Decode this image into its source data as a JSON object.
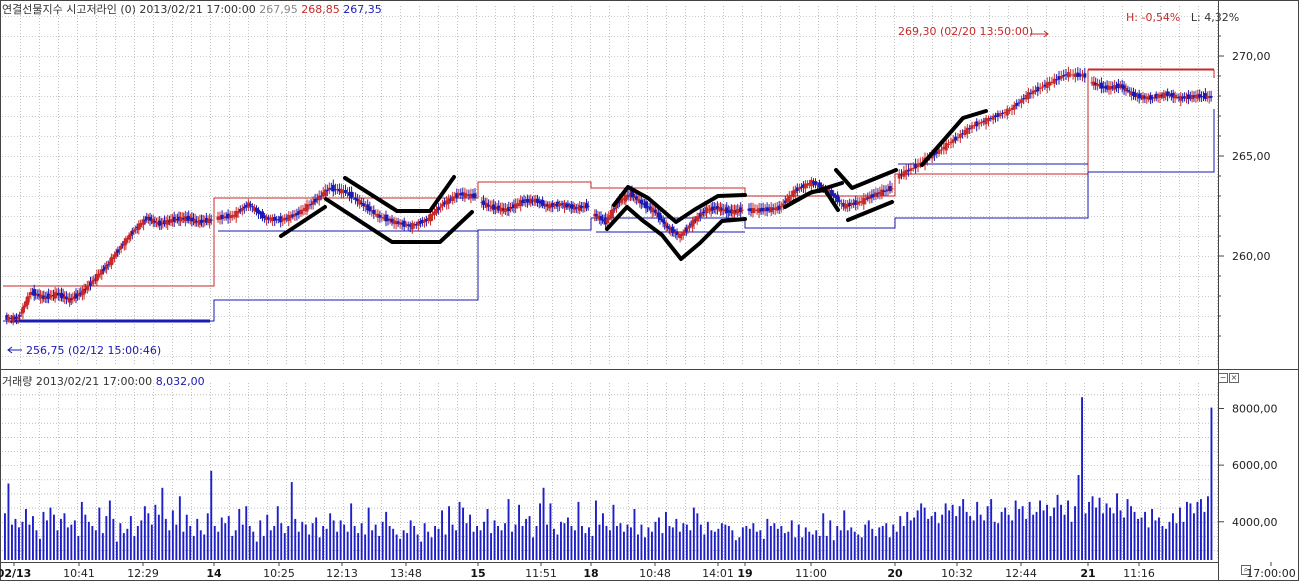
{
  "header": {
    "title": "연결선물지수 시고저라인",
    "param": "(0)",
    "datetime": "2013/02/21 17:00:00",
    "open": "267,95",
    "high": "268,85",
    "low": "267,35",
    "range_h": "H: -0,54%",
    "range_l": "L: 4,32%"
  },
  "volume_header": {
    "title": "거래량",
    "datetime": "2013/02/21 17:00:00",
    "value": "8,032,00"
  },
  "annotations": {
    "max_label": "269,30 (02/20 13:50:00)",
    "min_label": "256,75 (02/12 15:00:46)"
  },
  "chart_data": [
    {
      "type": "candlestick",
      "title": "연결선물지수 시고저라인",
      "y_ticks": [
        "270,00",
        "265,00",
        "260,00"
      ],
      "y_tick_values": [
        270,
        265,
        260
      ],
      "ylim": [
        254.5,
        272.5
      ],
      "x_tick_labels": [
        "02/13",
        "10:41",
        "12:29",
        "14",
        "10:25",
        "12:13",
        "13:48",
        "15",
        "11:51",
        "18",
        "10:48",
        "14:01",
        "19",
        "11:00",
        "20",
        "10:32",
        "12:44",
        "21",
        "11:16",
        "17:00:00"
      ],
      "day_labels": [
        "02/13",
        "14",
        "15",
        "18",
        "19",
        "20",
        "21"
      ],
      "grid": true,
      "colors": {
        "up": "#c82828",
        "down": "#1a1ab4",
        "high_line": "#c82828",
        "low_line": "#1a1ab4",
        "grid": "#9a9a9a"
      },
      "days": [
        {
          "label": "02/13",
          "closes": [
            256.9,
            258.2,
            257.9,
            258.1,
            257.8,
            258.2,
            258.9,
            259.6,
            260.5,
            261.3,
            261.9,
            261.6,
            261.8,
            261.9,
            261.7,
            261.8
          ]
        },
        {
          "label": "14",
          "closes": [
            262.0,
            262.6,
            261.9,
            261.8,
            262.1,
            262.7,
            263.4,
            263.2,
            262.6,
            262.0,
            261.7,
            261.5,
            261.8,
            262.6,
            263.1,
            263.0
          ]
        },
        {
          "label": "15",
          "closes": [
            262.4,
            262.3,
            262.7,
            262.8,
            262.5,
            262.6,
            262.4,
            262.5
          ]
        },
        {
          "label": "18",
          "closes": [
            261.7,
            262.7,
            263.1,
            262.6,
            262.2,
            261.4,
            261.0,
            261.7,
            262.3,
            262.4,
            262.2,
            262.3
          ]
        },
        {
          "label": "19",
          "closes": [
            262.3,
            262.4,
            263.3,
            263.7,
            263.3,
            262.5,
            262.7,
            263.1,
            263.4
          ]
        },
        {
          "label": "20",
          "closes": [
            264.5,
            265.1,
            265.8,
            266.5,
            266.9,
            267.3,
            268.1,
            268.6,
            269.1,
            269.0
          ]
        },
        {
          "label": "21",
          "closes": [
            268.4,
            268.5,
            268.0,
            267.9,
            268.1,
            267.9,
            268.0,
            267.95
          ]
        }
      ],
      "day_high": [
        258.5,
        262.9,
        263.7,
        263.4,
        263.0,
        264.1,
        269.3,
        268.9
      ],
      "day_low": [
        256.75,
        257.8,
        261.3,
        261.9,
        261.4,
        261.9,
        264.2,
        267.35
      ],
      "series": [
        {
          "name": "",
          "type": "high-line"
        },
        {
          "name": "",
          "type": "low-line"
        }
      ]
    },
    {
      "type": "bar",
      "title": "거래량",
      "y_ticks": [
        "8000,00",
        "6000,00",
        "4000,00"
      ],
      "y_tick_values": [
        8000,
        6000,
        4000
      ],
      "ylim": [
        2650,
        8900
      ],
      "last_value": 8032,
      "values": [
        4300,
        5350,
        3900,
        4100,
        3800,
        4000,
        4450,
        3900,
        4200,
        3700,
        3400,
        4350,
        4050,
        4500,
        4250,
        3700,
        4100,
        4300,
        3800,
        3900,
        4050,
        3500,
        4700,
        4250,
        4000,
        3850,
        3700,
        4500,
        3600,
        4200,
        4750,
        4100,
        3300,
        3950,
        3600,
        3750,
        4200,
        3500,
        3850,
        4050,
        4550,
        4300,
        3900,
        4600,
        4250,
        5200,
        4100,
        3700,
        4400,
        3900,
        4900,
        3650,
        4250,
        3850,
        3500,
        4100,
        3700,
        3550,
        4300,
        5800,
        3850,
        3650,
        4150,
        3950,
        4200,
        3500,
        3700,
        4450,
        3900,
        4550,
        3850,
        3650,
        3300,
        4050,
        3500,
        4250,
        3700,
        3850,
        4550,
        3950,
        3600,
        3850,
        5400,
        4100,
        3650,
        4000,
        3900,
        3550,
        3950,
        4150,
        3450,
        3850,
        3750,
        4300,
        4050,
        3650,
        4050,
        3900,
        3650,
        4650,
        3850,
        3600,
        3950,
        3550,
        4500,
        3700,
        3900,
        3500,
        4000,
        4350,
        3850,
        3750,
        3550,
        3400,
        3700,
        3600,
        4050,
        3850,
        3550,
        3300,
        3950,
        3650,
        3450,
        3850,
        3750,
        4400,
        3550,
        4550,
        3900,
        3700,
        4700,
        4500,
        3950,
        4250,
        3650,
        3850,
        3700,
        4000,
        4450,
        3600,
        4050,
        3850,
        3700,
        3950,
        4800,
        3650,
        3900,
        4600,
        3850,
        4100,
        4200,
        3450,
        3850,
        4650,
        5200,
        3900,
        4650,
        3750,
        3550,
        4000,
        3950,
        4150,
        3850,
        3700,
        4700,
        3850,
        3600,
        3800,
        3500,
        4750,
        3900,
        4300,
        3850,
        3700,
        4600,
        3850,
        3950,
        3650,
        3900,
        3800,
        4450,
        3550,
        3900,
        3450,
        3800,
        3650,
        4000,
        4150,
        3600,
        4350,
        3850,
        3800,
        4100,
        3650,
        3950,
        3900,
        3700,
        4500,
        4300,
        3900,
        3550,
        4000,
        3700,
        3650,
        3750,
        3950,
        3900,
        3850,
        3700,
        3350,
        3450,
        3800,
        3850,
        3750,
        3950,
        3650,
        3700,
        3400,
        4100,
        3850,
        3950,
        3750,
        3850,
        3600,
        3650,
        4050,
        3450,
        3900,
        3450,
        3800,
        3650,
        3550,
        3700,
        3500,
        4300,
        3500,
        4050,
        3350,
        3850,
        3700,
        4400,
        3700,
        3800,
        3650,
        3550,
        3450,
        3900,
        4050,
        3750,
        3500,
        3800,
        3850,
        3950,
        3450,
        3900,
        3650,
        4200,
        3850,
        4350,
        4050,
        4150,
        4400,
        4650,
        4500,
        4100,
        4200,
        4350,
        3950,
        4250,
        4650,
        4400,
        4600,
        4200,
        4550,
        4800,
        4350,
        4200,
        4050,
        4700,
        4250,
        4050,
        4550,
        4800,
        4000,
        3950,
        4350,
        4500,
        4250,
        4050,
        4750,
        4450,
        4550,
        4100,
        4700,
        4250,
        4350,
        4750,
        4400,
        4600,
        4200,
        4500,
        4950,
        4600,
        4250,
        4750,
        4000,
        4550,
        5650,
        8400,
        4300,
        4700,
        4900,
        4500,
        4850,
        4300,
        4650,
        4500,
        4300,
        5000,
        4400,
        4150,
        4800,
        4550,
        4350,
        4100,
        4150,
        4350,
        3800,
        4450,
        4050,
        4150,
        3850,
        3750,
        4000,
        4300,
        3950,
        4500,
        4000,
        4700,
        4650,
        4300,
        4700,
        4800,
        4350,
        4900,
        8032
      ]
    }
  ]
}
